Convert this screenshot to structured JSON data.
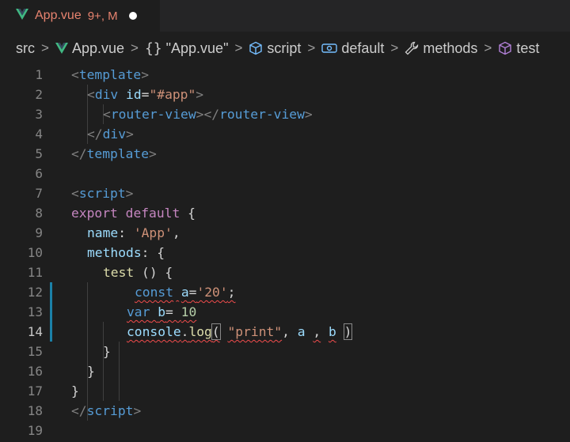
{
  "tab": {
    "filename": "App.vue",
    "badge": "9+, M"
  },
  "breadcrumb": {
    "items": [
      {
        "label": "src",
        "icon": ""
      },
      {
        "label": "App.vue",
        "icon": "vue-icon"
      },
      {
        "label": "\"App.vue\"",
        "icon": "braces-icon"
      },
      {
        "label": "script",
        "icon": "cube-icon"
      },
      {
        "label": "default",
        "icon": "module-icon"
      },
      {
        "label": "methods",
        "icon": "wrench-icon"
      },
      {
        "label": "test",
        "icon": "cube-icon"
      }
    ]
  },
  "editor": {
    "active_line": 14,
    "lines": [
      {
        "n": "1"
      },
      {
        "n": "2"
      },
      {
        "n": "3"
      },
      {
        "n": "4"
      },
      {
        "n": "5"
      },
      {
        "n": "6"
      },
      {
        "n": "7"
      },
      {
        "n": "8"
      },
      {
        "n": "9"
      },
      {
        "n": "10"
      },
      {
        "n": "11"
      },
      {
        "n": "12"
      },
      {
        "n": "13"
      },
      {
        "n": "14"
      },
      {
        "n": "15"
      },
      {
        "n": "16"
      },
      {
        "n": "17"
      },
      {
        "n": "18"
      },
      {
        "n": "19"
      }
    ],
    "tokens": {
      "l1": [
        "<",
        "template",
        ">"
      ],
      "l2": [
        "<",
        "div",
        " ",
        "id",
        "=",
        "\"#app\"",
        ">"
      ],
      "l3": [
        "<",
        "router-view",
        "></",
        "router-view",
        ">"
      ],
      "l4": [
        "</",
        "div",
        ">"
      ],
      "l5": [
        "</",
        "template",
        ">"
      ],
      "l7": [
        "<",
        "script",
        ">"
      ],
      "l8": [
        "export",
        " ",
        "default",
        " {"
      ],
      "l9": [
        "name",
        ": ",
        "'App'",
        ","
      ],
      "l10": [
        "methods",
        ": {"
      ],
      "l11": [
        "test",
        " () {"
      ],
      "l12": [
        "const",
        " ",
        "a",
        "=",
        "'20'",
        ";"
      ],
      "l13": [
        "var",
        " ",
        "b",
        "= ",
        "10"
      ],
      "l14": [
        "console",
        ".",
        "log",
        "(",
        " ",
        "\"print\"",
        ", ",
        "a",
        " ",
        ",",
        " ",
        "b",
        " ",
        ")"
      ],
      "l15": [
        "}"
      ],
      "l16": [
        "}"
      ],
      "l17": [
        "}"
      ],
      "l18": [
        "</",
        "script",
        ">"
      ]
    }
  },
  "colors": {
    "accent_modified": "#1b81a8",
    "error_squiggle": "#f14c4c",
    "vue_green": "#41b883"
  }
}
